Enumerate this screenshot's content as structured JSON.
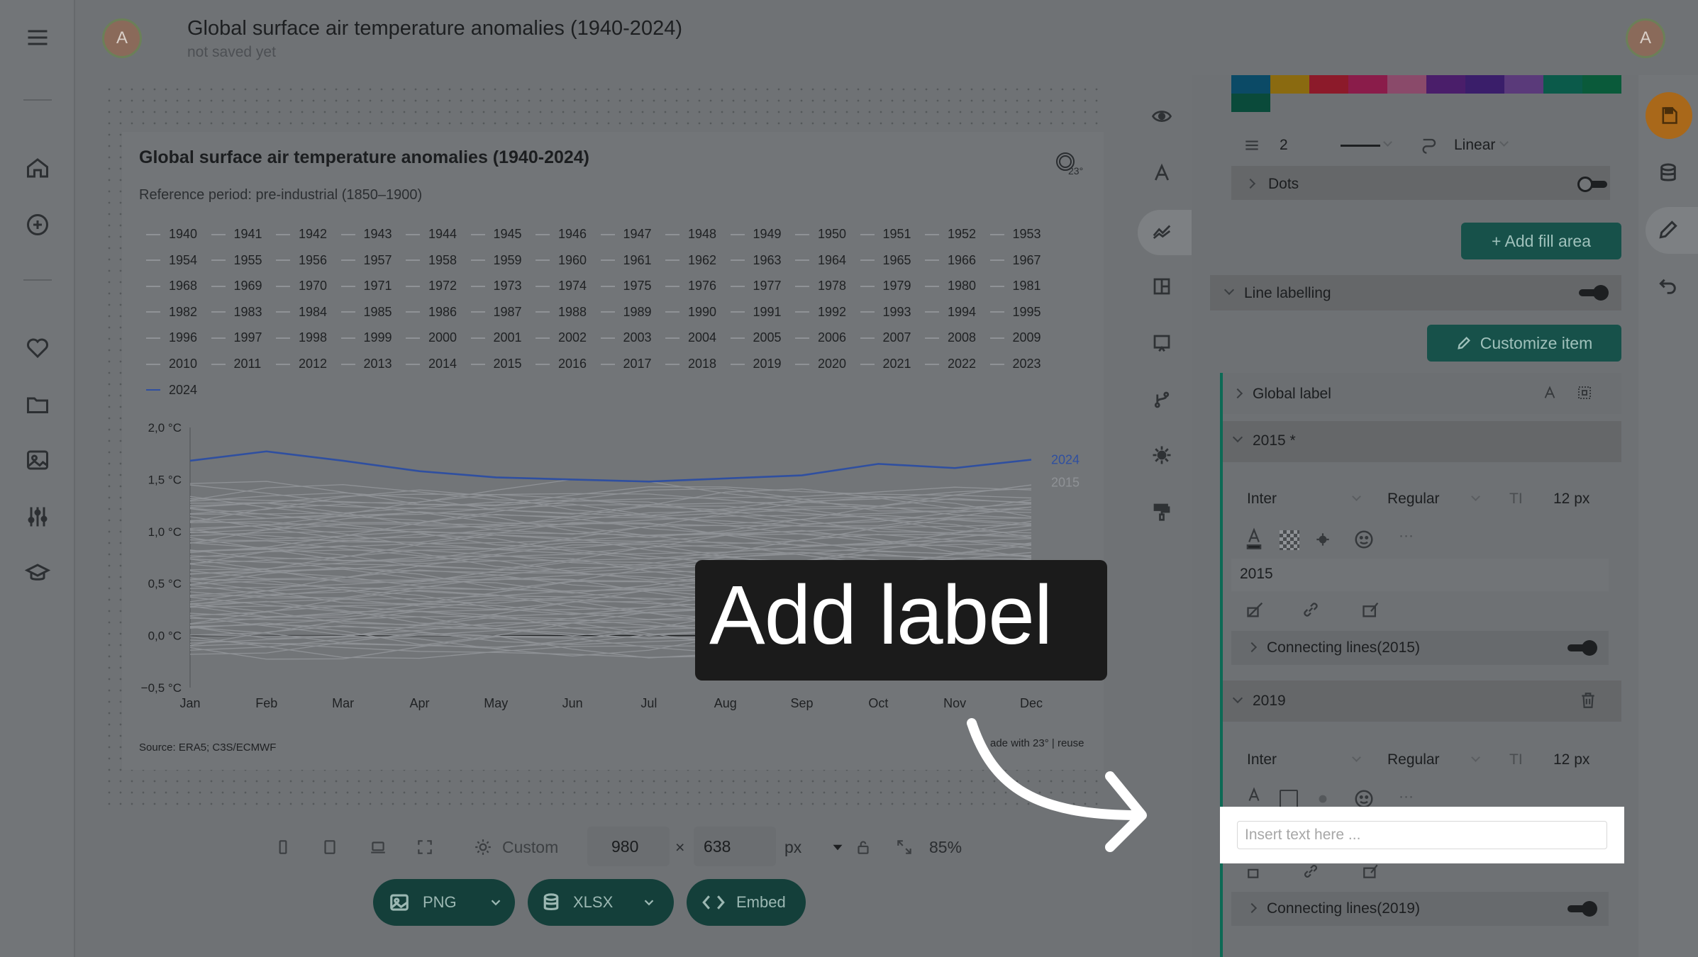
{
  "header": {
    "title": "Global surface air temperature anomalies (1940-2024)",
    "subtitle": "not saved yet",
    "avatar_initial": "A"
  },
  "left_rail": {
    "icons": [
      "menu-icon",
      "home-icon",
      "add-circle-icon",
      "heart-icon",
      "folder-icon",
      "image-icon",
      "sliders-icon",
      "graduation-cap-icon"
    ]
  },
  "chart_data": {
    "type": "line",
    "title": "Global surface air temperature anomalies (1940-2024)",
    "subtitle": "Reference period: pre-industrial (1850–1900)",
    "source": "Source: ERA5; C3S/ECMWF",
    "credit": "ade with 23° | reuse",
    "x": [
      "Jan",
      "Feb",
      "Mar",
      "Apr",
      "May",
      "Jun",
      "Jul",
      "Aug",
      "Sep",
      "Oct",
      "Nov",
      "Dec"
    ],
    "y_ticks": [
      "2,0 °C",
      "1,5 °C",
      "1,0 °C",
      "0,5 °C",
      "0,0 °C",
      "−0,5 °C"
    ],
    "ylim": [
      -0.5,
      2.0
    ],
    "legend": [
      "1940",
      "1941",
      "1942",
      "1943",
      "1944",
      "1945",
      "1946",
      "1947",
      "1948",
      "1949",
      "1950",
      "1951",
      "1952",
      "1953",
      "1954",
      "1955",
      "1956",
      "1957",
      "1958",
      "1959",
      "1960",
      "1961",
      "1962",
      "1963",
      "1964",
      "1965",
      "1966",
      "1967",
      "1968",
      "1969",
      "1970",
      "1971",
      "1972",
      "1973",
      "1974",
      "1975",
      "1976",
      "1977",
      "1978",
      "1979",
      "1980",
      "1981",
      "1982",
      "1983",
      "1984",
      "1985",
      "1986",
      "1987",
      "1988",
      "1989",
      "1990",
      "1991",
      "1992",
      "1993",
      "1994",
      "1995",
      "1996",
      "1997",
      "1998",
      "1999",
      "2000",
      "2001",
      "2002",
      "2003",
      "2004",
      "2005",
      "2006",
      "2007",
      "2008",
      "2009",
      "2010",
      "2011",
      "2012",
      "2013",
      "2014",
      "2015",
      "2016",
      "2017",
      "2018",
      "2019",
      "2020",
      "2021",
      "2022",
      "2023",
      "2024"
    ],
    "highlight_series": {
      "name": "2024",
      "color": "#2f4fa0",
      "values": [
        1.68,
        1.77,
        1.68,
        1.58,
        1.52,
        1.5,
        1.48,
        1.51,
        1.54,
        1.65,
        1.61,
        1.69
      ]
    },
    "end_labels": [
      "2024",
      "2015"
    ],
    "background_color": "#8f9296",
    "zero_line": true
  },
  "overlay": {
    "add_label": "Add label"
  },
  "bottom_toolbar": {
    "preset": "Custom",
    "width": "980",
    "height": "638",
    "times": "×",
    "unit": "px",
    "zoom": "85%",
    "png_label": "PNG",
    "xlsx_label": "XLSX",
    "embed_label": "Embed"
  },
  "tool_strip": [
    "eye-icon",
    "text-icon",
    "line-chart-icon",
    "layout-icon",
    "annotation-icon",
    "branch-icon",
    "gear-icon",
    "paint-roller-icon"
  ],
  "panel": {
    "palette": [
      "#0b4a66",
      "#8a6a10",
      "#8c1a2a",
      "#8a1c4a",
      "#8a4a6a",
      "#4a1e6a",
      "#3a1e6a",
      "#5a3a7a",
      "#0b5a4a",
      "#0a5a3a",
      "#0a4a3a"
    ],
    "line_width": "2",
    "curve": "Linear",
    "dots_label": "Dots",
    "add_fill_area": "+ Add fill area",
    "line_labelling": "Line labelling",
    "customize_item": "Customize item",
    "global_label": "Global label",
    "item_2015": {
      "title": "2015 *",
      "font": "Inter",
      "weight": "Regular",
      "size": "12 px",
      "text": "2015",
      "connecting": "Connecting lines(2015)"
    },
    "item_2019": {
      "title": "2019",
      "font": "Inter",
      "weight": "Regular",
      "size": "12 px",
      "placeholder": "Insert text here ...",
      "connecting": "Connecting lines(2019)"
    }
  }
}
